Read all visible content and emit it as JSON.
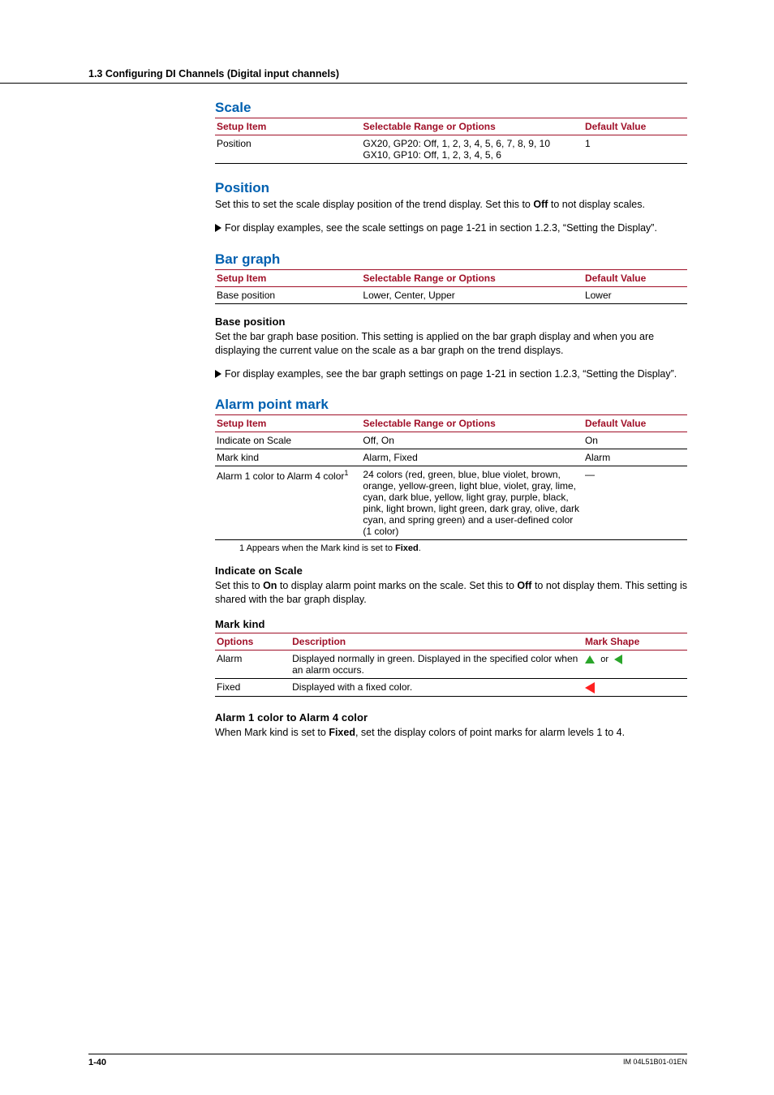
{
  "section_header": "1.3  Configuring DI Channels (Digital input channels)",
  "footer": {
    "page": "1-40",
    "doc_no": "IM 04L51B01-01EN"
  },
  "table_headers": {
    "setup": "Setup Item",
    "options": "Selectable Range or Options",
    "default": "Default Value",
    "options2": "Options",
    "desc": "Description",
    "markshape": "Mark Shape"
  },
  "scale": {
    "title": "Scale",
    "rows": [
      {
        "item": "Position",
        "opt": "GX20, GP20: Off, 1, 2, 3, 4, 5, 6, 7, 8, 9, 10\nGX10, GP10: Off, 1, 2, 3, 4, 5, 6",
        "def": "1"
      }
    ]
  },
  "position": {
    "title": "Position",
    "body_pre": "Set this to set the scale display position of the trend display. Set this to ",
    "body_bold": "Off",
    "body_post": " to not display scales.",
    "note": "For display examples, see the scale settings on page 1-21 in section 1.2.3, “Setting the Display”."
  },
  "bar": {
    "title": "Bar graph",
    "rows": [
      {
        "item": "Base position",
        "opt": "Lower, Center, Upper",
        "def": "Lower"
      }
    ],
    "sub": "Base position",
    "body": "Set the bar graph base position. This setting is applied on the bar graph display and when you are displaying the current value on the scale as a bar graph on the trend displays.",
    "note": "For display examples, see the bar graph settings on page 1-21 in section 1.2.3, “Setting the Display”."
  },
  "alarm": {
    "title": "Alarm point mark",
    "rows": [
      {
        "item": "Indicate on Scale",
        "itemsup": "",
        "opt": "Off, On",
        "def": "On"
      },
      {
        "item": "Mark kind",
        "itemsup": "",
        "opt": "Alarm, Fixed",
        "def": "Alarm"
      },
      {
        "item": "Alarm 1 color to Alarm 4 color",
        "itemsup": "1",
        "opt": "24 colors (red, green, blue, blue violet, brown, orange, yellow-green, light blue, violet, gray, lime, cyan, dark blue, yellow, light gray, purple, black, pink, light brown, light green, dark gray, olive, dark cyan, and spring green) and a user-defined color (1 color)",
        "def": "—"
      }
    ],
    "footnote_pre": "1   Appears when the Mark kind is set to ",
    "footnote_bold": "Fixed",
    "footnote_post": ".",
    "ind_title": "Indicate on Scale",
    "ind_pre": "Set this to ",
    "ind_b1": "On",
    "ind_mid": " to display alarm point marks on the scale. Set this to ",
    "ind_b2": "Off",
    "ind_post": " to not display them. This setting is shared with the bar graph display.",
    "mk_title": "Mark kind",
    "mk_rows": [
      {
        "opt": "Alarm",
        "desc": "Displayed normally in green. Displayed in the specified color when an alarm occurs.",
        "or": "or"
      },
      {
        "opt": "Fixed",
        "desc": "Displayed with a fixed color.",
        "or": ""
      }
    ],
    "ac_title": "Alarm 1 color to Alarm 4 color",
    "ac_pre": "When Mark kind is set to ",
    "ac_bold": "Fixed",
    "ac_post": ", set the display colors of point marks for alarm levels 1 to 4."
  },
  "chart_data": {
    "type": "table",
    "tables": [
      {
        "name": "Scale",
        "columns": [
          "Setup Item",
          "Selectable Range or Options",
          "Default Value"
        ],
        "rows": [
          [
            "Position",
            "GX20, GP20: Off, 1, 2, 3, 4, 5, 6, 7, 8, 9, 10 / GX10, GP10: Off, 1, 2, 3, 4, 5, 6",
            "1"
          ]
        ]
      },
      {
        "name": "Bar graph",
        "columns": [
          "Setup Item",
          "Selectable Range or Options",
          "Default Value"
        ],
        "rows": [
          [
            "Base position",
            "Lower, Center, Upper",
            "Lower"
          ]
        ]
      },
      {
        "name": "Alarm point mark",
        "columns": [
          "Setup Item",
          "Selectable Range or Options",
          "Default Value"
        ],
        "rows": [
          [
            "Indicate on Scale",
            "Off, On",
            "On"
          ],
          [
            "Mark kind",
            "Alarm, Fixed",
            "Alarm"
          ],
          [
            "Alarm 1 color to Alarm 4 color",
            "24 colors (red, green, blue, blue violet, brown, orange, yellow-green, light blue, violet, gray, lime, cyan, dark blue, yellow, light gray, purple, black, pink, light brown, light green, dark gray, olive, dark cyan, and spring green) and a user-defined color (1 color)",
            "—"
          ]
        ]
      },
      {
        "name": "Mark kind",
        "columns": [
          "Options",
          "Description",
          "Mark Shape"
        ],
        "rows": [
          [
            "Alarm",
            "Displayed normally in green. Displayed in the specified color when an alarm occurs.",
            "green triangle"
          ],
          [
            "Fixed",
            "Displayed with a fixed color.",
            "red triangle"
          ]
        ]
      }
    ]
  }
}
